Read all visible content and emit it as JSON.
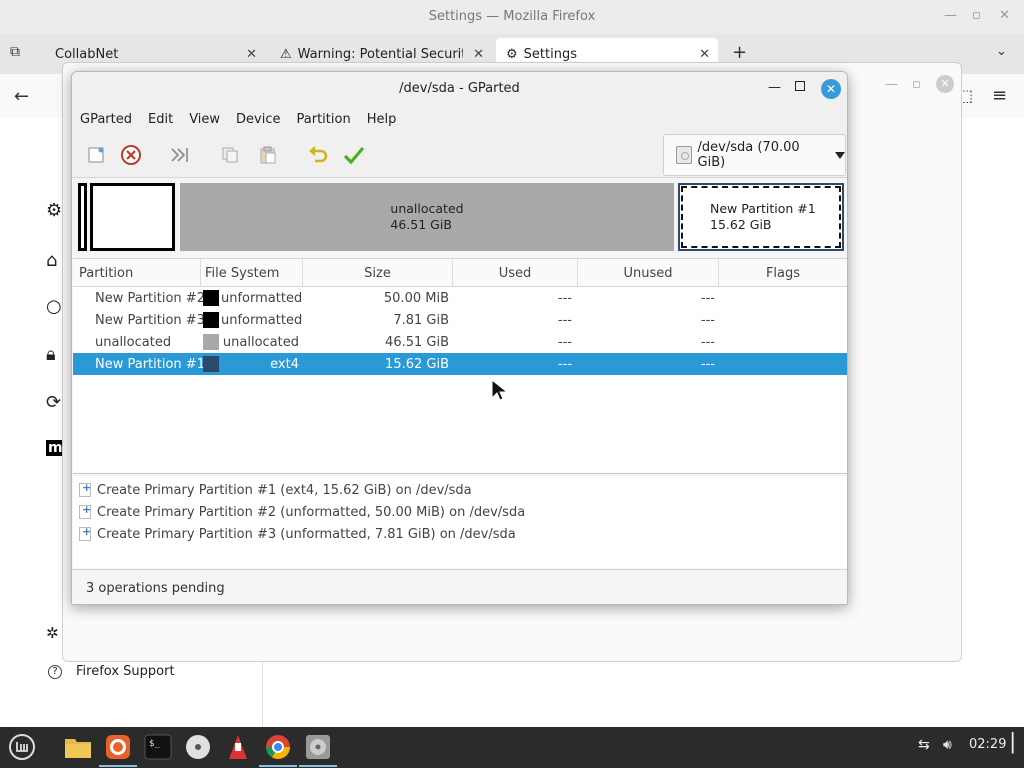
{
  "firefox": {
    "title": "Settings — Mozilla Firefox",
    "tabs": [
      {
        "label": "CollabNet"
      },
      {
        "label": "Warning: Potential Security"
      },
      {
        "label": "Settings"
      }
    ],
    "support_label": "Firefox Support"
  },
  "gparted": {
    "title": "/dev/sda - GParted",
    "menu": [
      "GParted",
      "Edit",
      "View",
      "Device",
      "Partition",
      "Help"
    ],
    "device_selector": "/dev/sda (70.00 GiB)",
    "diskmap": {
      "unallocated": {
        "name": "unallocated",
        "size": "46.51 GiB"
      },
      "new1": {
        "name": "New Partition #1",
        "size": "15.62 GiB"
      }
    },
    "columns": [
      "Partition",
      "File System",
      "Size",
      "Used",
      "Unused",
      "Flags"
    ],
    "rows": [
      {
        "partition": "New Partition #2",
        "fs": "unformatted",
        "fs_color": "#000000",
        "size": "50.00 MiB",
        "used": "---",
        "unused": "---",
        "flags": ""
      },
      {
        "partition": "New Partition #3",
        "fs": "unformatted",
        "fs_color": "#000000",
        "size": "7.81 GiB",
        "used": "---",
        "unused": "---",
        "flags": ""
      },
      {
        "partition": "unallocated",
        "fs": "unallocated",
        "fs_color": "#a9a9a9",
        "size": "46.51 GiB",
        "used": "---",
        "unused": "---",
        "flags": ""
      },
      {
        "partition": "New Partition #1",
        "fs": "ext4",
        "fs_color": "#2c4a6e",
        "size": "15.62 GiB",
        "used": "---",
        "unused": "---",
        "flags": ""
      }
    ],
    "selected_row": 3,
    "operations": [
      "Create Primary Partition #1 (ext4, 15.62 GiB) on /dev/sda",
      "Create Primary Partition #2 (unformatted, 50.00 MiB) on /dev/sda",
      "Create Primary Partition #3 (unformatted, 7.81 GiB) on /dev/sda"
    ],
    "status": "3 operations pending"
  },
  "taskbar": {
    "apps": [
      "mint-menu-icon",
      "files-icon",
      "firefox-icon",
      "terminal-icon",
      "disc-icon",
      "installer-icon",
      "chrome-icon",
      "gparted-icon"
    ],
    "clock": "02:29"
  },
  "colors": {
    "selection": "#2a9ad6",
    "unallocated": "#a9a9a9",
    "ext4": "#2c4a6e",
    "unformatted": "#000000"
  }
}
